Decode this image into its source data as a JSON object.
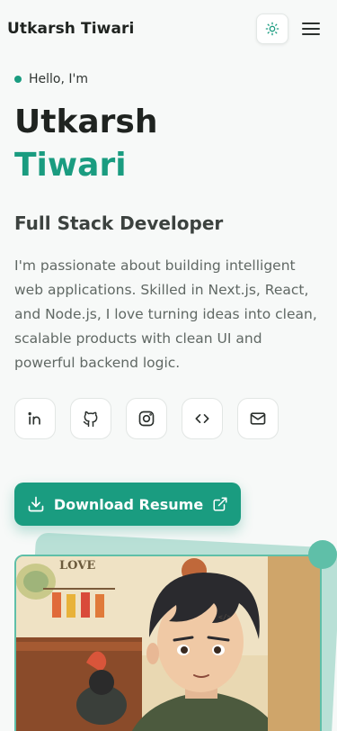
{
  "header": {
    "brand": "Utkarsh Tiwari"
  },
  "hero": {
    "greeting": "Hello, I'm",
    "first_name": "Utkarsh",
    "last_name": "Tiwari",
    "role": "Full Stack Developer",
    "bio": "I'm passionate about building intelligent web applications. Skilled in Next.js, React, and Node.js, I love turning ideas into clean, scalable products with clean UI and powerful backend logic."
  },
  "socials": [
    "linkedin-icon",
    "github-icon",
    "instagram-icon",
    "code-icon",
    "mail-icon"
  ],
  "cta": {
    "download_label": "Download Resume"
  },
  "photo": {
    "sign_text": "LOVE"
  },
  "colors": {
    "accent": "#1a9c80",
    "text": "#1f2320",
    "muted": "#606864",
    "background": "#f7f9f8"
  }
}
